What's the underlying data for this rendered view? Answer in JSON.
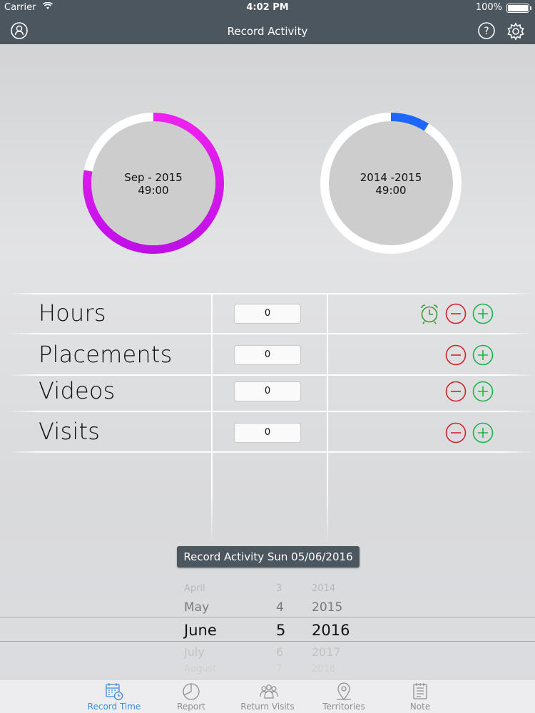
{
  "status_bar": {
    "carrier": "Carrier",
    "time": "4:02 PM",
    "battery": "100%"
  },
  "nav": {
    "title": "Record Activity",
    "left_icon": "profile-icon",
    "right_icons": [
      "help-icon",
      "gear-icon"
    ]
  },
  "rings": [
    {
      "label_line1": "Sep - 2015",
      "label_line2": "49:00",
      "progress": 0.78,
      "color_start": "#ee22ee",
      "color_end": "#c010e6"
    },
    {
      "label_line1": "2014 -2015",
      "label_line2": "49:00",
      "progress": 0.09,
      "color_start": "#1f66ff",
      "color_end": "#1f66ff"
    }
  ],
  "activities": [
    {
      "label": "Hours",
      "value": "0",
      "has_timer": true
    },
    {
      "label": "Placements",
      "value": "0",
      "has_timer": false
    },
    {
      "label": "Videos",
      "value": "0",
      "has_timer": false
    },
    {
      "label": "Visits",
      "value": "0",
      "has_timer": false
    }
  ],
  "record_button": "Record Activity Sun 05/06/2016",
  "picker": {
    "months": [
      "April",
      "May",
      "June",
      "July",
      "August"
    ],
    "days": [
      "3",
      "4",
      "5",
      "6",
      "7"
    ],
    "years": [
      "2014",
      "2015",
      "2016",
      "2017",
      "2018"
    ],
    "selected_index": 2
  },
  "tabs": [
    {
      "label": "Record Time",
      "icon": "calendar-clock-icon",
      "active": true
    },
    {
      "label": "Report",
      "icon": "pie-chart-icon",
      "active": false
    },
    {
      "label": "Return Visits",
      "icon": "people-icon",
      "active": false
    },
    {
      "label": "Territories",
      "icon": "map-pin-icon",
      "active": false
    },
    {
      "label": "Note",
      "icon": "note-icon",
      "active": false
    }
  ],
  "colors": {
    "bar": "#4b565f",
    "minus": "#d0242a",
    "plus": "#1bb34a",
    "timer": "#3a9a3a",
    "tab_active": "#3b8ee0"
  }
}
